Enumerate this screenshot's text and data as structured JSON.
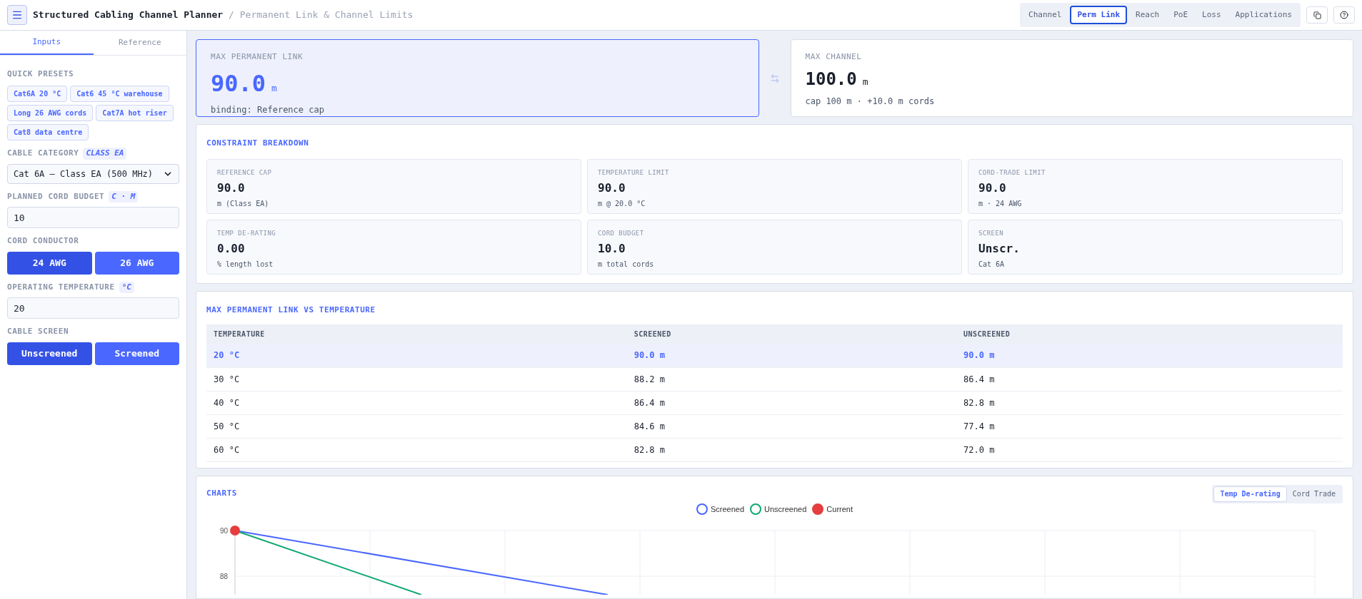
{
  "header": {
    "title": "Structured Cabling Channel Planner",
    "subtitle": "/ Permanent Link & Channel Limits",
    "tabs": [
      {
        "label": "Channel",
        "selected": false
      },
      {
        "label": "Perm Link",
        "selected": true
      },
      {
        "label": "Reach",
        "selected": false
      },
      {
        "label": "PoE",
        "selected": false
      },
      {
        "label": "Loss",
        "selected": false
      },
      {
        "label": "Applications",
        "selected": false
      }
    ]
  },
  "sidebar": {
    "tabs": [
      {
        "label": "Inputs",
        "selected": true
      },
      {
        "label": "Reference",
        "selected": false
      }
    ],
    "presets_label": "QUICK PRESETS",
    "presets": [
      "Cat6A 20 °C",
      "Cat6 45 °C warehouse",
      "Long 26 AWG cords",
      "Cat7A hot riser",
      "Cat8 data centre"
    ],
    "fields": [
      {
        "kind": "select",
        "label": "CABLE CATEGORY",
        "tag": "CLASS EA",
        "value": "Cat 6A — Class EA (500 MHz)"
      },
      {
        "kind": "input",
        "label": "PLANNED CORD BUDGET",
        "tag": "C · M",
        "value": "10"
      },
      {
        "kind": "segmented",
        "label": "CORD CONDUCTOR",
        "options": [
          {
            "label": "24 AWG",
            "selected": true
          },
          {
            "label": "26 AWG",
            "selected": false
          }
        ]
      },
      {
        "kind": "input",
        "label": "OPERATING TEMPERATURE",
        "tag": "°C",
        "value": "20"
      },
      {
        "kind": "segmented",
        "label": "CABLE SCREEN",
        "options": [
          {
            "label": "Unscreened",
            "selected": true
          },
          {
            "label": "Screened",
            "selected": false
          }
        ]
      }
    ]
  },
  "summary": [
    {
      "label": "MAX PERMANENT LINK",
      "value": "90.0",
      "unit": "m",
      "note": "binding: Reference cap",
      "selected": true
    },
    {
      "label": "MAX CHANNEL",
      "value": "100.0",
      "unit": "m",
      "note": "cap 100 m · +10.0 m cords",
      "selected": false
    }
  ],
  "breakdown": {
    "title": "CONSTRAINT BREAKDOWN",
    "items": [
      {
        "label": "REFERENCE CAP",
        "value": "90.0",
        "note": "m (Class EA)"
      },
      {
        "label": "TEMPERATURE LIMIT",
        "value": "90.0",
        "note": "m @ 20.0 °C"
      },
      {
        "label": "CORD-TRADE LIMIT",
        "value": "90.0",
        "note": "m · 24 AWG"
      },
      {
        "label": "TEMP DE-RATING",
        "value": "0.00",
        "note": "% length lost"
      },
      {
        "label": "CORD BUDGET",
        "value": "10.0",
        "note": "m total cords"
      },
      {
        "label": "SCREEN",
        "value": "Unscr.",
        "note": "Cat 6A"
      }
    ]
  },
  "table": {
    "title": "MAX PERMANENT LINK VS TEMPERATURE",
    "columns": [
      "TEMPERATURE",
      "SCREENED",
      "UNSCREENED"
    ],
    "rows": [
      {
        "cells": [
          "20 °C",
          "90.0 m",
          "90.0 m"
        ],
        "selected": true
      },
      {
        "cells": [
          "30 °C",
          "88.2 m",
          "86.4 m"
        ],
        "selected": false
      },
      {
        "cells": [
          "40 °C",
          "86.4 m",
          "82.8 m"
        ],
        "selected": false
      },
      {
        "cells": [
          "50 °C",
          "84.6 m",
          "77.4 m"
        ],
        "selected": false
      },
      {
        "cells": [
          "60 °C",
          "82.8 m",
          "72.0 m"
        ],
        "selected": false
      }
    ]
  },
  "charts": {
    "title": "CHARTS",
    "tabs": [
      {
        "label": "Temp De-rating",
        "selected": true
      },
      {
        "label": "Cord Trade",
        "selected": false
      }
    ],
    "legend": [
      {
        "label": "Screened",
        "color": "#4a67ff",
        "kind": "line"
      },
      {
        "label": "Unscreened",
        "color": "#10a870",
        "kind": "line"
      },
      {
        "label": "Current",
        "color": "#e53e3e",
        "kind": "point"
      }
    ],
    "y_tick_labels": [
      "90",
      "88"
    ]
  }
}
